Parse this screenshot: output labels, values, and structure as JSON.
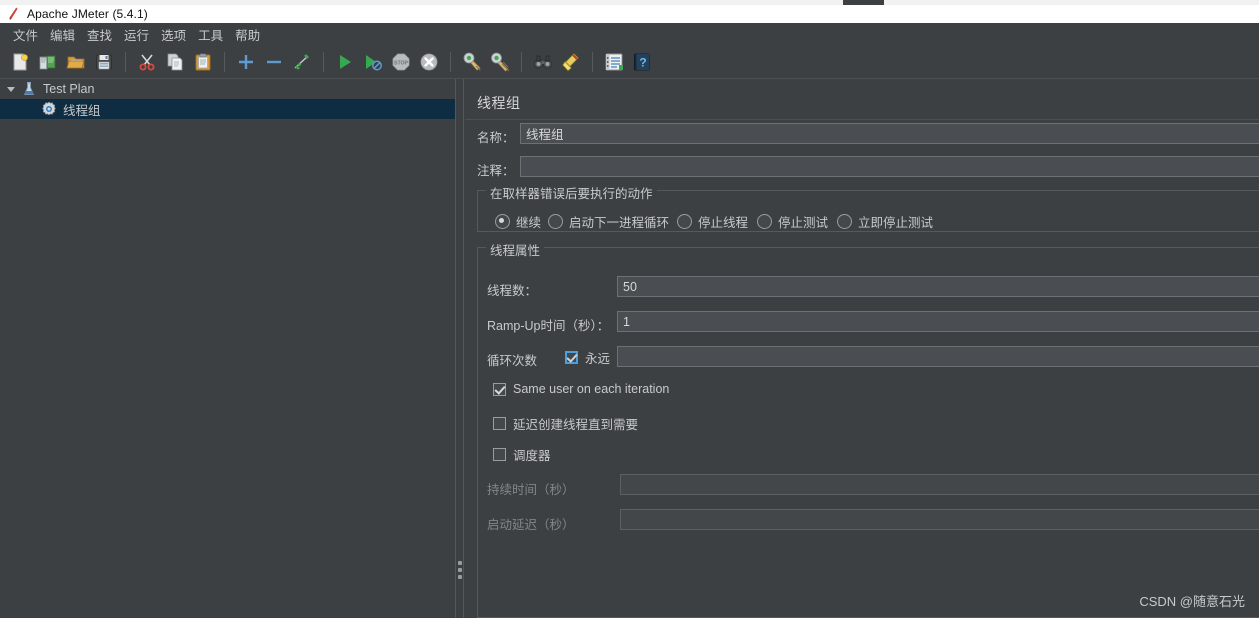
{
  "window": {
    "title": "Apache JMeter (5.4.1)",
    "icon": "jmeter-feather-icon"
  },
  "menubar": {
    "items": [
      {
        "label": "文件",
        "name": "menu-file"
      },
      {
        "label": "编辑",
        "name": "menu-edit"
      },
      {
        "label": "查找",
        "name": "menu-search"
      },
      {
        "label": "运行",
        "name": "menu-run"
      },
      {
        "label": "选项",
        "name": "menu-options"
      },
      {
        "label": "工具",
        "name": "menu-tools"
      },
      {
        "label": "帮助",
        "name": "menu-help"
      }
    ]
  },
  "toolbar": {
    "buttons": [
      {
        "icon": "new-document-icon",
        "tip": "新建"
      },
      {
        "icon": "open-templates-icon",
        "tip": "模板"
      },
      {
        "icon": "open-folder-icon",
        "tip": "打开"
      },
      {
        "icon": "save-floppy-icon",
        "tip": "保存"
      },
      {
        "sep": true
      },
      {
        "icon": "cut-scissors-icon",
        "tip": "剪切"
      },
      {
        "icon": "copy-pages-icon",
        "tip": "复制"
      },
      {
        "icon": "paste-clipboard-icon",
        "tip": "粘贴"
      },
      {
        "sep": true
      },
      {
        "icon": "plus-expand-icon",
        "tip": "展开全部"
      },
      {
        "icon": "minus-collapse-icon",
        "tip": "折叠全部"
      },
      {
        "icon": "toggle-enable-icon",
        "tip": "切换"
      },
      {
        "sep": true
      },
      {
        "icon": "start-play-icon",
        "tip": "启动"
      },
      {
        "icon": "start-no-pauses-icon",
        "tip": "无停顿启动"
      },
      {
        "icon": "stop-sign-icon",
        "tip": "停止"
      },
      {
        "icon": "shutdown-x-icon",
        "tip": "关闭"
      },
      {
        "sep": true
      },
      {
        "icon": "clear-broom-icon",
        "tip": "清除"
      },
      {
        "icon": "clear-all-broom-icon",
        "tip": "清除全部"
      },
      {
        "sep": true
      },
      {
        "icon": "search-binoculars-icon",
        "tip": "查找"
      },
      {
        "icon": "reset-search-broom-icon",
        "tip": "重置查找"
      },
      {
        "sep": true
      },
      {
        "icon": "function-helper-icon",
        "tip": "函数助手"
      },
      {
        "icon": "help-book-icon",
        "tip": "帮助"
      }
    ]
  },
  "tree": {
    "nodes": [
      {
        "label": "Test Plan",
        "icon": "test-plan-icon",
        "selected": false,
        "expanded": true,
        "depth": 0
      },
      {
        "label": "线程组",
        "icon": "thread-group-gear-icon",
        "selected": true,
        "expanded": false,
        "depth": 1
      }
    ]
  },
  "config": {
    "title": "线程组",
    "name_label": "名称：",
    "name_value": "线程组",
    "comment_label": "注释：",
    "comment_value": "",
    "error_action": {
      "group_label": "在取样器错误后要执行的动作",
      "options": [
        {
          "label": "继续",
          "checked": true
        },
        {
          "label": "启动下一进程循环",
          "checked": false
        },
        {
          "label": "停止线程",
          "checked": false
        },
        {
          "label": "停止测试",
          "checked": false
        },
        {
          "label": "立即停止测试",
          "checked": false
        }
      ]
    },
    "thread_props": {
      "group_label": "线程属性",
      "threads_label": "线程数：",
      "threads_value": "50",
      "rampup_label": "Ramp-Up时间（秒）：",
      "rampup_value": "1",
      "loops_label": "循环次数",
      "loops_forever_label": "永远",
      "loops_forever_checked": true,
      "loops_value": "",
      "same_user_label": "Same user on each iteration",
      "same_user_checked": true,
      "delay_create_label": "延迟创建线程直到需要",
      "delay_create_checked": false,
      "scheduler_label": "调度器",
      "scheduler_checked": false,
      "duration_label": "持续时间（秒）",
      "duration_value": "",
      "duration_disabled": true,
      "startup_delay_label": "启动延迟（秒）",
      "startup_delay_value": "",
      "startup_delay_disabled": true
    }
  },
  "watermark": {
    "text": "CSDN @随意石光"
  },
  "colors": {
    "window_bg": "#3c4043",
    "titlebar_bg": "#ffffff",
    "selection": "#0e2c42",
    "field_bg": "#4a4e52",
    "accent": "#4a9fe0",
    "text": "#c8cacb",
    "text_disabled": "#82868a"
  }
}
